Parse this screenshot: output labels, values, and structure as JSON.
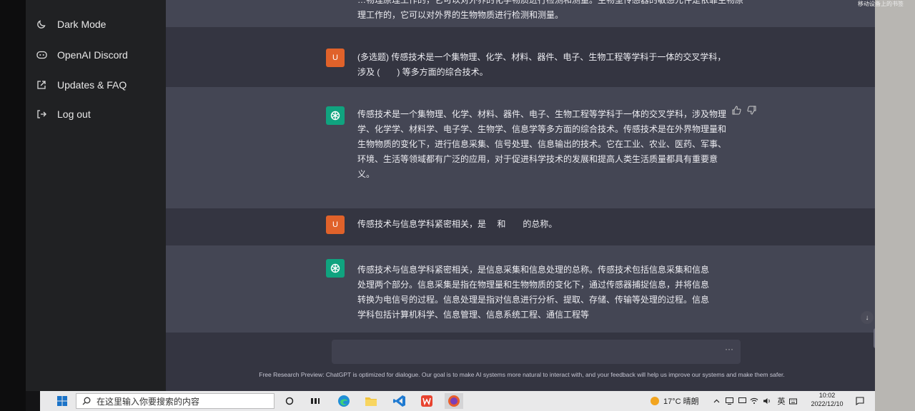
{
  "sidebar": {
    "items": [
      {
        "label": "Dark Mode",
        "icon": "moon-icon"
      },
      {
        "label": "OpenAI Discord",
        "icon": "discord-icon"
      },
      {
        "label": "Updates & FAQ",
        "icon": "external-link-icon"
      },
      {
        "label": "Log out",
        "icon": "logout-icon"
      }
    ]
  },
  "topright": "移动设备上的书签",
  "conversation": {
    "partial_top": "…物理原理工作的，它可以对外界的化学物质进行检测和测量。生物型传感器的敏感元件是依靠生物原理工作的，它可以对外界的生物物质进行检测和测量。",
    "messages": [
      {
        "role": "user",
        "avatar": "U",
        "text": "(多选题) 传感技术是一个集物理、化学、材料、器件、电子、生物工程等学科于一体的交叉学科，涉及 (　　) 等多方面的综合技术。"
      },
      {
        "role": "assistant",
        "text": "传感技术是一个集物理、化学、材料、器件、电子、生物工程等学科于一体的交叉学科，涉及物理学、化学学、材料学、电子学、生物学、信息学等多方面的综合技术。传感技术是在外界物理量和生物物质的变化下，进行信息采集、信号处理、信息输出的技术。它在工业、农业、医药、军事、环境、生活等领域都有广泛的应用，对于促进科学技术的发展和提高人类生活质量都具有重要意义。"
      },
      {
        "role": "user",
        "avatar": "U",
        "text": "传感技术与信息学科紧密相关，是　 和　　的总称。"
      },
      {
        "role": "assistant",
        "text": "传感技术与信息学科紧密相关，是信息采集和信息处理的总称。传感技术包括信息采集和信息处理两个部分。信息采集是指在物理量和生物物质的变化下，通过传感器捕捉信息，并将信息转换为电信号的过程。信息处理是指对信息进行分析、提取、存储、传输等处理的过程。信息学科包括计算机科学、信息管理、信息系统工程、通信工程等"
      }
    ]
  },
  "input": {
    "dots": "···"
  },
  "footer": "Free Research Preview: ChatGPT is optimized for dialogue. Our goal is to make AI systems more natural to interact with, and your feedback will help us improve our systems and make them safer.",
  "taskbar": {
    "search_placeholder": "在这里输入你要搜索的内容",
    "weather": "17°C 晴朗",
    "ime": "英",
    "time": "10:02",
    "date": "2022/12/10"
  },
  "colors": {
    "user_avatar": "#e0622a",
    "assistant_avatar": "#10a37f",
    "main_bg": "#343541",
    "assistant_bg": "#444654",
    "sidebar_bg": "#202123"
  }
}
